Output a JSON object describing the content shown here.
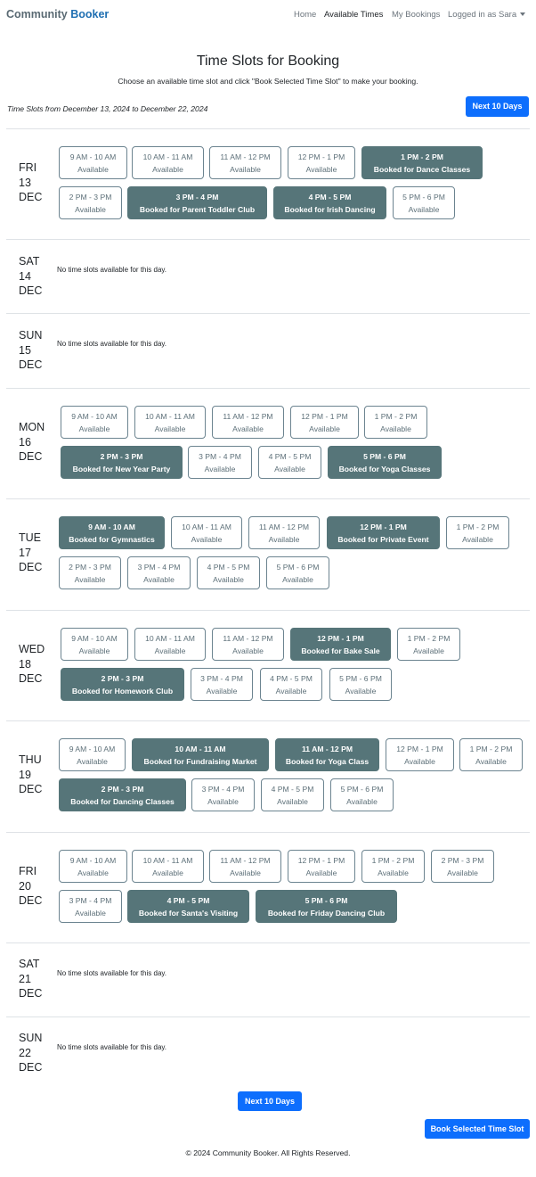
{
  "brand": {
    "part1": "Community",
    "part2": "Booker"
  },
  "nav": {
    "home": "Home",
    "available_times": "Available Times",
    "my_bookings": "My Bookings",
    "user": "Logged in as Sara"
  },
  "page": {
    "title": "Time Slots for Booking",
    "subtitle": "Choose an available time slot and click \"Book Selected Time Slot\" to make your booking.",
    "range": "Time Slots from December 13, 2024 to December 22, 2024",
    "next_label": "Next 10 Days",
    "book_label": "Book Selected Time Slot",
    "no_slots": "No time slots available for this day.",
    "available_label": "Available"
  },
  "days": [
    {
      "dow": "FRI",
      "date": "13",
      "mon": "DEC",
      "slots": [
        {
          "time": "9 AM - 10 AM",
          "status": "Available"
        },
        {
          "time": "10 AM - 11 AM",
          "status": "Available"
        },
        {
          "time": "11 AM - 12 PM",
          "status": "Available"
        },
        {
          "time": "12 PM - 1 PM",
          "status": "Available"
        },
        {
          "time": "1 PM - 2 PM",
          "status": "Booked for Dance Classes"
        },
        {
          "time": "2 PM - 3 PM",
          "status": "Available"
        },
        {
          "time": "3 PM - 4 PM",
          "status": "Booked for Parent Toddler Club"
        },
        {
          "time": "4 PM - 5 PM",
          "status": "Booked for Irish Dancing"
        },
        {
          "time": "5 PM - 6 PM",
          "status": "Available"
        }
      ]
    },
    {
      "dow": "SAT",
      "date": "14",
      "mon": "DEC",
      "slots": []
    },
    {
      "dow": "SUN",
      "date": "15",
      "mon": "DEC",
      "slots": []
    },
    {
      "dow": "MON",
      "date": "16",
      "mon": "DEC",
      "slots": [
        {
          "time": "9 AM - 10 AM",
          "status": "Available"
        },
        {
          "time": "10 AM - 11 AM",
          "status": "Available"
        },
        {
          "time": "11 AM - 12 PM",
          "status": "Available"
        },
        {
          "time": "12 PM - 1 PM",
          "status": "Available"
        },
        {
          "time": "1 PM - 2 PM",
          "status": "Available"
        },
        {
          "time": "2 PM - 3 PM",
          "status": "Booked for New Year Party"
        },
        {
          "time": "3 PM - 4 PM",
          "status": "Available"
        },
        {
          "time": "4 PM - 5 PM",
          "status": "Available"
        },
        {
          "time": "5 PM - 6 PM",
          "status": "Booked for Yoga Classes"
        }
      ]
    },
    {
      "dow": "TUE",
      "date": "17",
      "mon": "DEC",
      "slots": [
        {
          "time": "9 AM - 10 AM",
          "status": "Booked for Gymnastics"
        },
        {
          "time": "10 AM - 11 AM",
          "status": "Available"
        },
        {
          "time": "11 AM - 12 PM",
          "status": "Available"
        },
        {
          "time": "12 PM - 1 PM",
          "status": "Booked for Private Event"
        },
        {
          "time": "1 PM - 2 PM",
          "status": "Available"
        },
        {
          "time": "2 PM - 3 PM",
          "status": "Available"
        },
        {
          "time": "3 PM - 4 PM",
          "status": "Available"
        },
        {
          "time": "4 PM - 5 PM",
          "status": "Available"
        },
        {
          "time": "5 PM - 6 PM",
          "status": "Available"
        }
      ]
    },
    {
      "dow": "WED",
      "date": "18",
      "mon": "DEC",
      "slots": [
        {
          "time": "9 AM - 10 AM",
          "status": "Available"
        },
        {
          "time": "10 AM - 11 AM",
          "status": "Available"
        },
        {
          "time": "11 AM - 12 PM",
          "status": "Available"
        },
        {
          "time": "12 PM - 1 PM",
          "status": "Booked for Bake Sale"
        },
        {
          "time": "1 PM - 2 PM",
          "status": "Available"
        },
        {
          "time": "2 PM - 3 PM",
          "status": "Booked for Homework Club"
        },
        {
          "time": "3 PM - 4 PM",
          "status": "Available"
        },
        {
          "time": "4 PM - 5 PM",
          "status": "Available"
        },
        {
          "time": "5 PM - 6 PM",
          "status": "Available"
        }
      ]
    },
    {
      "dow": "THU",
      "date": "19",
      "mon": "DEC",
      "slots": [
        {
          "time": "9 AM - 10 AM",
          "status": "Available"
        },
        {
          "time": "10 AM - 11 AM",
          "status": "Booked for Fundraising Market"
        },
        {
          "time": "11 AM - 12 PM",
          "status": "Booked for Yoga Class"
        },
        {
          "time": "12 PM - 1 PM",
          "status": "Available"
        },
        {
          "time": "1 PM - 2 PM",
          "status": "Available"
        },
        {
          "time": "2 PM - 3 PM",
          "status": "Booked for Dancing Classes"
        },
        {
          "time": "3 PM - 4 PM",
          "status": "Available"
        },
        {
          "time": "4 PM - 5 PM",
          "status": "Available"
        },
        {
          "time": "5 PM - 6 PM",
          "status": "Available"
        }
      ]
    },
    {
      "dow": "FRI",
      "date": "20",
      "mon": "DEC",
      "slots": [
        {
          "time": "9 AM - 10 AM",
          "status": "Available"
        },
        {
          "time": "10 AM - 11 AM",
          "status": "Available"
        },
        {
          "time": "11 AM - 12 PM",
          "status": "Available"
        },
        {
          "time": "12 PM - 1 PM",
          "status": "Available"
        },
        {
          "time": "1 PM - 2 PM",
          "status": "Available"
        },
        {
          "time": "2 PM - 3 PM",
          "status": "Available"
        },
        {
          "time": "3 PM - 4 PM",
          "status": "Available"
        },
        {
          "time": "4 PM - 5 PM",
          "status": "Booked for Santa's Visiting"
        },
        {
          "time": "5 PM - 6 PM",
          "status": "Booked for Friday Dancing Club"
        }
      ]
    },
    {
      "dow": "SAT",
      "date": "21",
      "mon": "DEC",
      "slots": []
    },
    {
      "dow": "SUN",
      "date": "22",
      "mon": "DEC",
      "slots": []
    }
  ],
  "footer": "© 2024 Community Booker. All Rights Reserved.",
  "colors": {
    "primary": "#0d6efd",
    "booked": "#567579",
    "available_border": "#6c8490"
  }
}
